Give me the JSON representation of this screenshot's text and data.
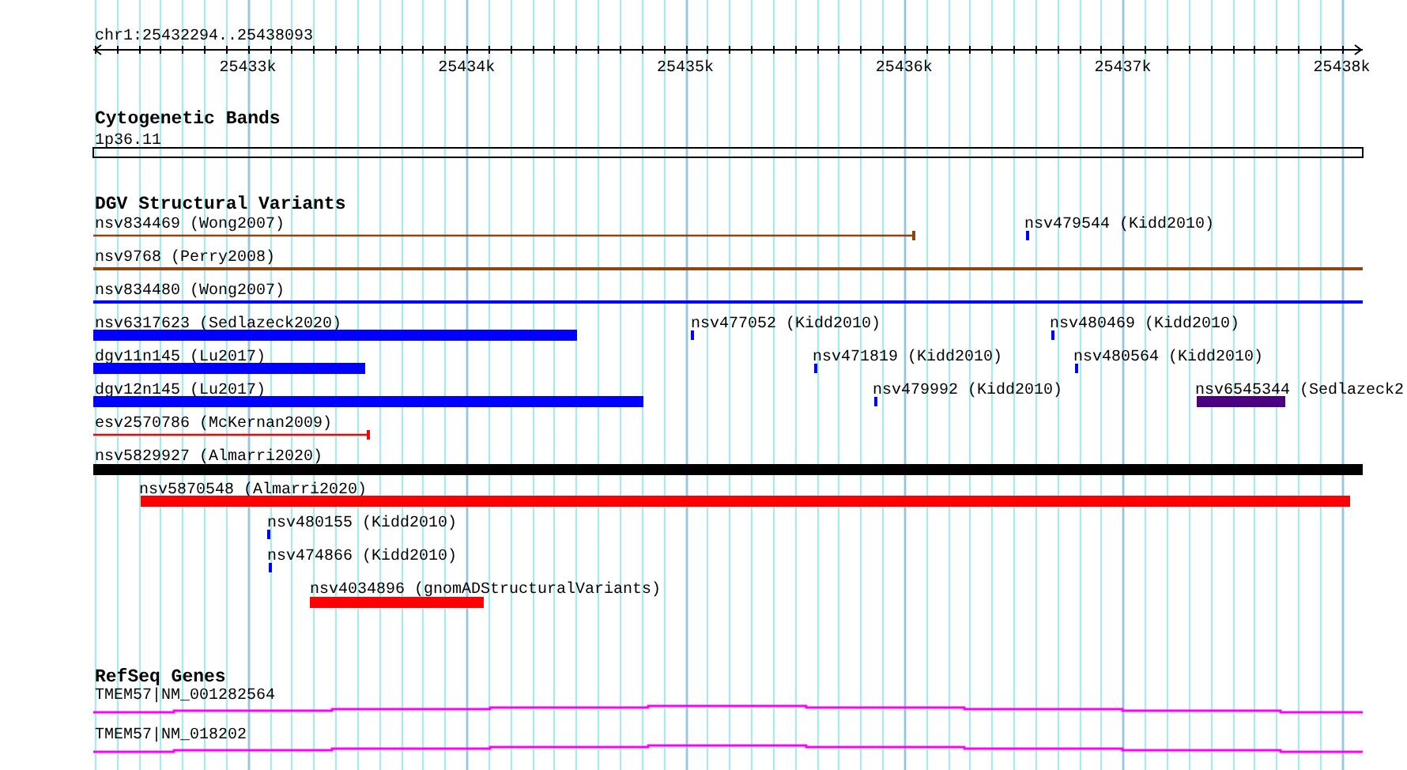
{
  "ruler": {
    "location": "chr1:25432294..25438093",
    "ticks": [
      "25433k",
      "25434k",
      "25435k",
      "25436k",
      "25437k",
      "25438k"
    ]
  },
  "tracks": [
    {
      "title": "Cytogenetic Bands",
      "kind": "bands",
      "features": [
        {
          "label": "1p36.11"
        }
      ]
    },
    {
      "title": "DGV Structural Variants",
      "kind": "variants",
      "features": [
        {
          "label": "nsv834469 (Wong2007)",
          "kind": "line",
          "color": "#8b4513"
        },
        {
          "label": "nsv479544 (Kidd2010)",
          "kind": "bar",
          "color": "#0000ff"
        },
        {
          "label": "nsv9768 (Perry2008)",
          "kind": "line",
          "color": "#8b4513"
        },
        {
          "label": "nsv834480 (Wong2007)",
          "kind": "line",
          "color": "#0000ff"
        },
        {
          "label": "nsv6317623 (Sedlazeck2020)",
          "kind": "bar",
          "color": "#0000ff"
        },
        {
          "label": "nsv477052 (Kidd2010)",
          "kind": "bar",
          "color": "#0000ff"
        },
        {
          "label": "nsv480469 (Kidd2010)",
          "kind": "bar",
          "color": "#0000ff"
        },
        {
          "label": "dgv11n145 (Lu2017)",
          "kind": "bar",
          "color": "#0000ff"
        },
        {
          "label": "nsv471819 (Kidd2010)",
          "kind": "bar",
          "color": "#0000ff"
        },
        {
          "label": "nsv480564 (Kidd2010)",
          "kind": "bar",
          "color": "#0000ff"
        },
        {
          "label": "dgv12n145 (Lu2017)",
          "kind": "bar",
          "color": "#0000ff"
        },
        {
          "label": "nsv479992 (Kidd2010)",
          "kind": "bar",
          "color": "#0000ff"
        },
        {
          "label": "nsv6545344 (Sedlazeck2",
          "kind": "bar",
          "color": "#4b0082"
        },
        {
          "label": "esv2570786 (McKernan2009)",
          "kind": "line",
          "color": "#ff0000"
        },
        {
          "label": "nsv5829927 (Almarri2020)",
          "kind": "bar",
          "color": "#000000"
        },
        {
          "label": "nsv5870548 (Almarri2020)",
          "kind": "bar",
          "color": "#ff0000"
        },
        {
          "label": "nsv480155 (Kidd2010)",
          "kind": "bar",
          "color": "#0000ff"
        },
        {
          "label": "nsv474866 (Kidd2010)",
          "kind": "bar",
          "color": "#0000ff"
        },
        {
          "label": "nsv4034896 (gnomADStructuralVariants)",
          "kind": "bar",
          "color": "#ff0000"
        }
      ]
    },
    {
      "title": "RefSeq Genes",
      "kind": "genes",
      "features": [
        {
          "label": "TMEM57|NM_001282564"
        },
        {
          "label": "TMEM57|NM_018202"
        }
      ]
    }
  ]
}
